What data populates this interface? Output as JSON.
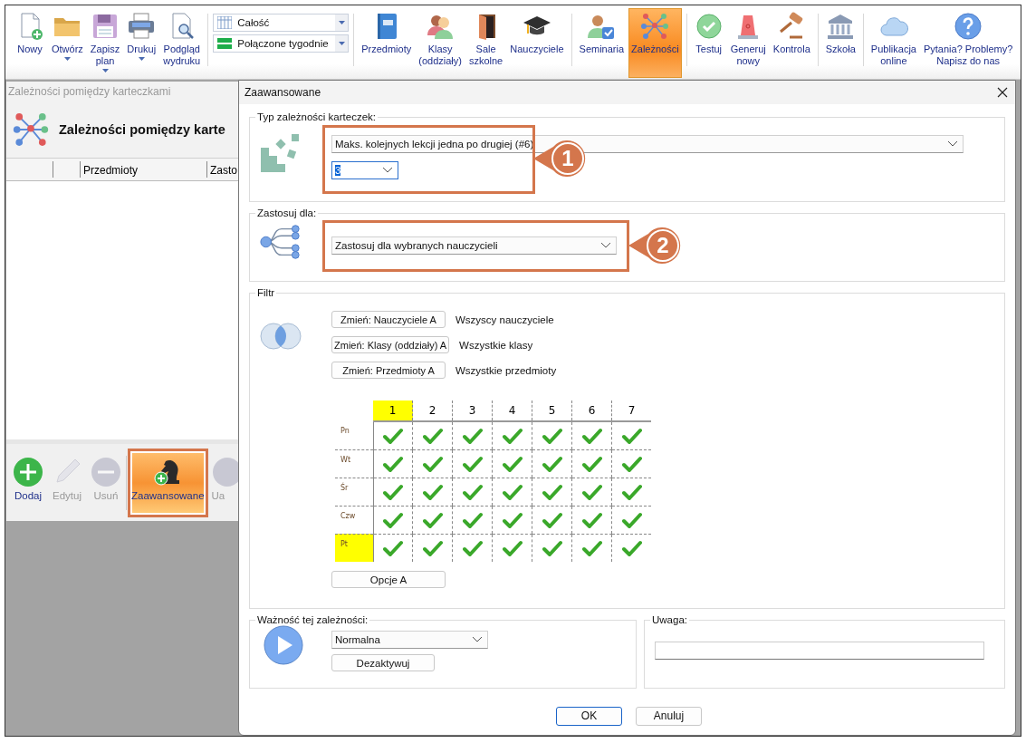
{
  "ribbon": {
    "groups": [
      {
        "kind": "buttons",
        "items": [
          {
            "label": "Nowy",
            "dropdown": false,
            "selected": false
          },
          {
            "label": "Otwórz",
            "dropdown": true,
            "selected": false
          },
          {
            "label": "Zapisz\nplan",
            "dropdown": true,
            "selected": false
          },
          {
            "label": "Drukuj",
            "dropdown": true,
            "selected": false
          },
          {
            "label": "Podgląd\nwydruku",
            "dropdown": false,
            "selected": false
          }
        ]
      },
      {
        "kind": "combos",
        "items": [
          {
            "value": "Całość"
          },
          {
            "value": "Połączone tygodnie"
          }
        ]
      },
      {
        "kind": "buttons",
        "items": [
          {
            "label": "Przedmioty",
            "dropdown": false,
            "selected": false
          },
          {
            "label": "Klasy\n(oddziały)",
            "dropdown": false,
            "selected": false
          },
          {
            "label": "Sale\nszkolne",
            "dropdown": false,
            "selected": false
          },
          {
            "label": "Nauczyciele",
            "dropdown": false,
            "selected": false
          }
        ]
      },
      {
        "kind": "buttons",
        "items": [
          {
            "label": "Seminaria",
            "dropdown": false,
            "selected": false
          },
          {
            "label": "Zależności",
            "dropdown": false,
            "selected": true
          }
        ]
      },
      {
        "kind": "buttons",
        "items": [
          {
            "label": "Testuj",
            "dropdown": false,
            "selected": false
          },
          {
            "label": "Generuj\nnowy",
            "dropdown": false,
            "selected": false
          },
          {
            "label": "Kontrola",
            "dropdown": false,
            "selected": false
          }
        ]
      },
      {
        "kind": "buttons",
        "items": [
          {
            "label": "Szkoła",
            "dropdown": false,
            "selected": false
          }
        ]
      },
      {
        "kind": "buttons",
        "items": [
          {
            "label": "Publikacja\nonline",
            "dropdown": false,
            "selected": false
          },
          {
            "label": "Pytania? Problemy?\nNapisz do nas",
            "dropdown": false,
            "selected": false
          }
        ]
      }
    ]
  },
  "left_window": {
    "title": "Zależności pomiędzy karteczkami",
    "heading": "Zależności pomiędzy karte",
    "table": {
      "columns": [
        {},
        {},
        {
          "label": "Przedmioty"
        },
        {
          "label": "Zasto"
        }
      ]
    },
    "toolbar": [
      {
        "label": "Dodaj",
        "disabled": false,
        "selected": false,
        "annotated": false
      },
      {
        "label": "Edytuj",
        "disabled": true,
        "selected": false,
        "annotated": false
      },
      {
        "label": "Usuń",
        "disabled": true,
        "selected": false,
        "annotated": false
      },
      {
        "label": "Zaawansowane",
        "disabled": false,
        "selected": true,
        "annotated": true
      },
      {
        "label": "Ua",
        "disabled": true,
        "selected": false,
        "annotated": false
      }
    ]
  },
  "dialog": {
    "title": "Zaawansowane",
    "type_section": {
      "legend": "Typ zależności karteczek:",
      "type": "Maks. kolejnych lekcji jedna po drugiej (#6)",
      "count": "3",
      "callout": "1"
    },
    "apply_section": {
      "legend": "Zastosuj dla:",
      "target": "Zastosuj dla wybranych nauczycieli",
      "callout": "2"
    },
    "filter_section": {
      "legend": "Filtr",
      "filters": [
        {
          "button": "Zmień: Nauczyciele A",
          "value": "Wszyscy nauczyciele"
        },
        {
          "button": "Zmień: Klasy (oddziały) A",
          "value": "Wszystkie klasy"
        },
        {
          "button": "Zmień: Przedmioty A",
          "value": "Wszystkie przedmioty"
        }
      ],
      "grid": {
        "columns": [
          {
            "label": "1",
            "highlighted": true
          },
          {
            "label": "2",
            "highlighted": false
          },
          {
            "label": "3",
            "highlighted": false
          },
          {
            "label": "4",
            "highlighted": false
          },
          {
            "label": "5",
            "highlighted": false
          },
          {
            "label": "6",
            "highlighted": false
          },
          {
            "label": "7",
            "highlighted": false
          }
        ],
        "rows": [
          {
            "label": "Pn",
            "highlighted": false,
            "cells": [
              {
                "checked": true
              },
              {
                "checked": true
              },
              {
                "checked": true
              },
              {
                "checked": true
              },
              {
                "checked": true
              },
              {
                "checked": true
              },
              {
                "checked": true
              }
            ]
          },
          {
            "label": "Wt",
            "highlighted": false,
            "cells": [
              {
                "checked": true
              },
              {
                "checked": true
              },
              {
                "checked": true
              },
              {
                "checked": true
              },
              {
                "checked": true
              },
              {
                "checked": true
              },
              {
                "checked": true
              }
            ]
          },
          {
            "label": "Śr",
            "highlighted": false,
            "cells": [
              {
                "checked": true
              },
              {
                "checked": true
              },
              {
                "checked": true
              },
              {
                "checked": true
              },
              {
                "checked": true
              },
              {
                "checked": true
              },
              {
                "checked": true
              }
            ]
          },
          {
            "label": "Czw",
            "highlighted": false,
            "cells": [
              {
                "checked": true
              },
              {
                "checked": true
              },
              {
                "checked": true
              },
              {
                "checked": true
              },
              {
                "checked": true
              },
              {
                "checked": true
              },
              {
                "checked": true
              }
            ]
          },
          {
            "label": "Pt",
            "highlighted": true,
            "cells": [
              {
                "checked": true
              },
              {
                "checked": true
              },
              {
                "checked": true
              },
              {
                "checked": true
              },
              {
                "checked": true
              },
              {
                "checked": true
              },
              {
                "checked": true
              }
            ]
          }
        ]
      },
      "options_button": "Opcje A"
    },
    "importance_section": {
      "legend": "Ważność tej zależności:",
      "value": "Normalna",
      "button": "Dezaktywuj"
    },
    "note_section": {
      "legend": "Uwaga:"
    },
    "buttons": [
      {
        "label": "OK",
        "default": true
      },
      {
        "label": "Anuluj",
        "default": false
      }
    ]
  }
}
